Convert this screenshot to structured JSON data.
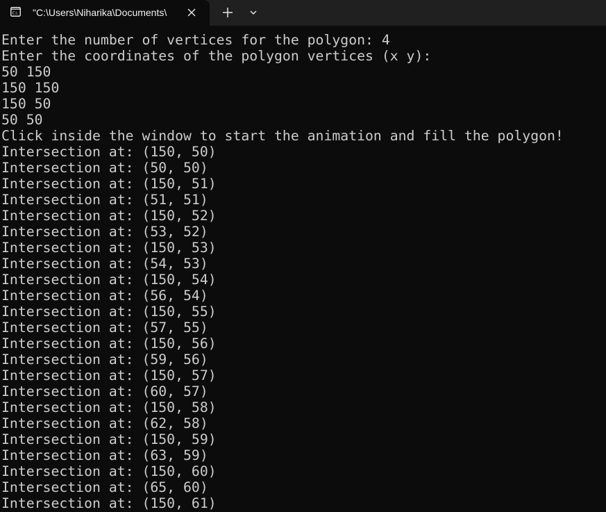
{
  "tab": {
    "title": "\"C:\\Users\\Niharika\\Documents\\",
    "icon": "console-icon"
  },
  "tabbar": {
    "close_icon": "close-icon",
    "new_tab_icon": "plus-icon",
    "dropdown_icon": "chevron-down-icon"
  },
  "console": {
    "lines": [
      "Enter the number of vertices for the polygon: 4",
      "Enter the coordinates of the polygon vertices (x y):",
      "50 150",
      "150 150",
      "150 50",
      "50 50",
      "Click inside the window to start the animation and fill the polygon!",
      "Intersection at: (150, 50)",
      "Intersection at: (50, 50)",
      "Intersection at: (150, 51)",
      "Intersection at: (51, 51)",
      "Intersection at: (150, 52)",
      "Intersection at: (53, 52)",
      "Intersection at: (150, 53)",
      "Intersection at: (54, 53)",
      "Intersection at: (150, 54)",
      "Intersection at: (56, 54)",
      "Intersection at: (150, 55)",
      "Intersection at: (57, 55)",
      "Intersection at: (150, 56)",
      "Intersection at: (59, 56)",
      "Intersection at: (150, 57)",
      "Intersection at: (60, 57)",
      "Intersection at: (150, 58)",
      "Intersection at: (62, 58)",
      "Intersection at: (150, 59)",
      "Intersection at: (63, 59)",
      "Intersection at: (150, 60)",
      "Intersection at: (65, 60)",
      "Intersection at: (150, 61)"
    ]
  },
  "colors": {
    "background": "#0c0c0c",
    "tabbar": "#202020",
    "text": "#cccccc"
  }
}
